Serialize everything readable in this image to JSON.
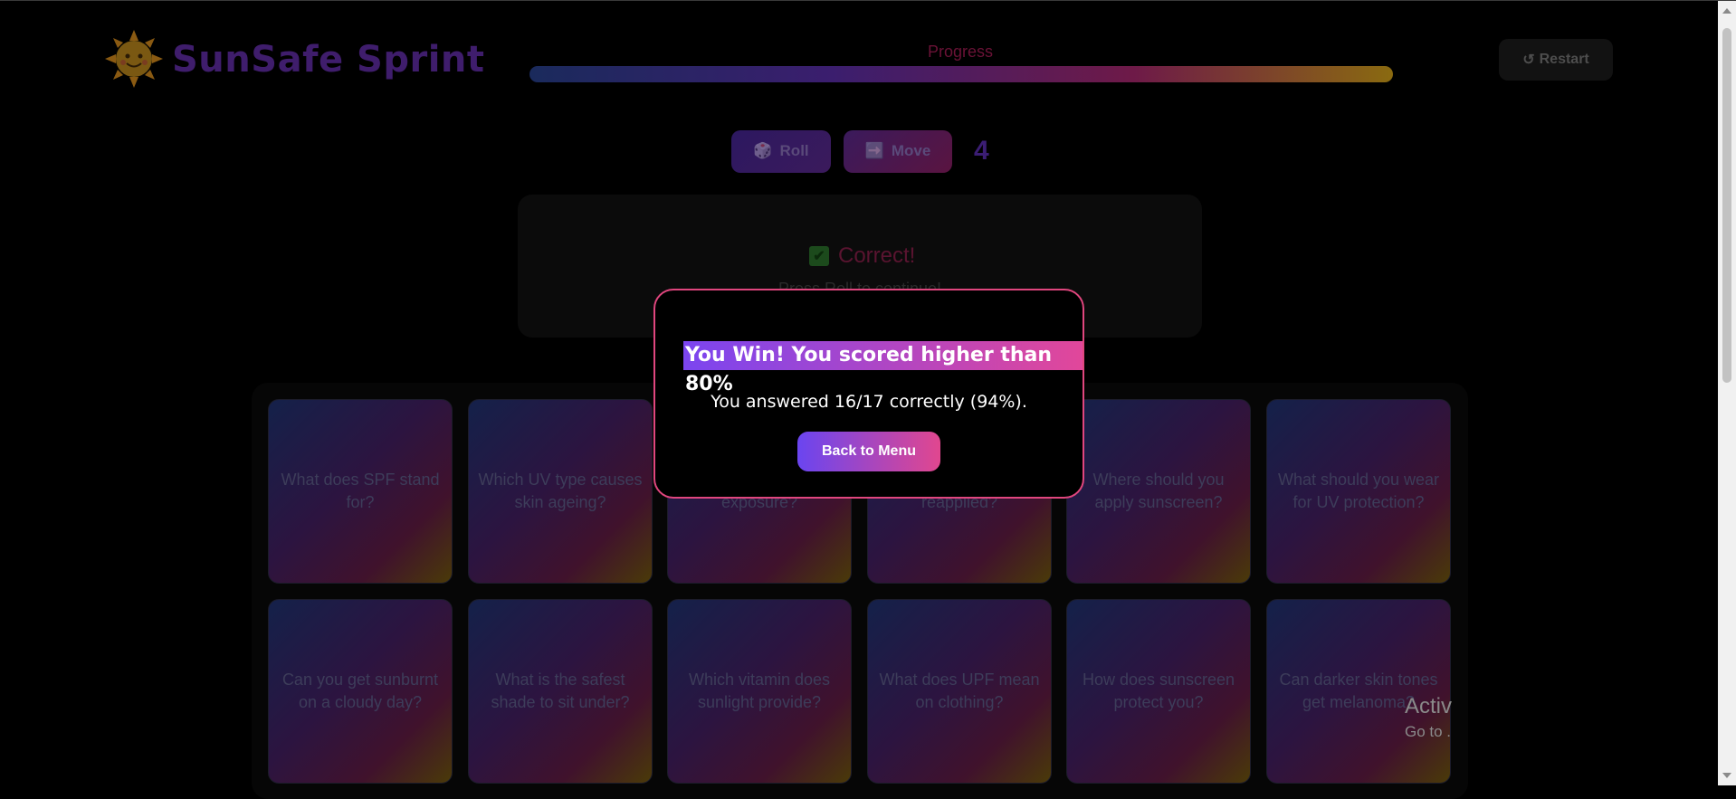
{
  "header": {
    "app_title": "SunSafe Sprint",
    "progress_label": "Progress",
    "progress_fraction": 1.0,
    "restart_label": "Restart",
    "restart_icon": "↺"
  },
  "controls": {
    "roll_label": "Roll",
    "roll_icon": "🎲",
    "move_label": "Move",
    "move_icon": "➡️",
    "dice_value": "4"
  },
  "feedback": {
    "title": "Correct!",
    "icon": "✔",
    "subtitle": "Press Roll to continue!"
  },
  "board": {
    "cards": [
      "What does SPF stand for?",
      "Which UV type causes skin ageing?",
      "Why should you limit exposure?",
      "When should it be reapplied?",
      "Where should you apply sunscreen?",
      "What should you wear for UV protection?",
      "Can you get sunburnt on a cloudy day?",
      "What is the safest shade to sit under?",
      "Which vitamin does sunlight provide?",
      "What does UPF mean on clothing?",
      "How does sunscreen protect you?",
      "Can darker skin tones get melanoma?"
    ]
  },
  "modal": {
    "title": "You Win! You scored higher than 80%",
    "message": "You answered 16/17 correctly (94%).",
    "button_label": "Back to Menu"
  },
  "watermark": {
    "line1": "Activ",
    "line2": "Go to ."
  },
  "colors": {
    "modal_border": "#e0467e",
    "accent_purple": "#7b45f0",
    "accent_pink": "#e1479a"
  }
}
